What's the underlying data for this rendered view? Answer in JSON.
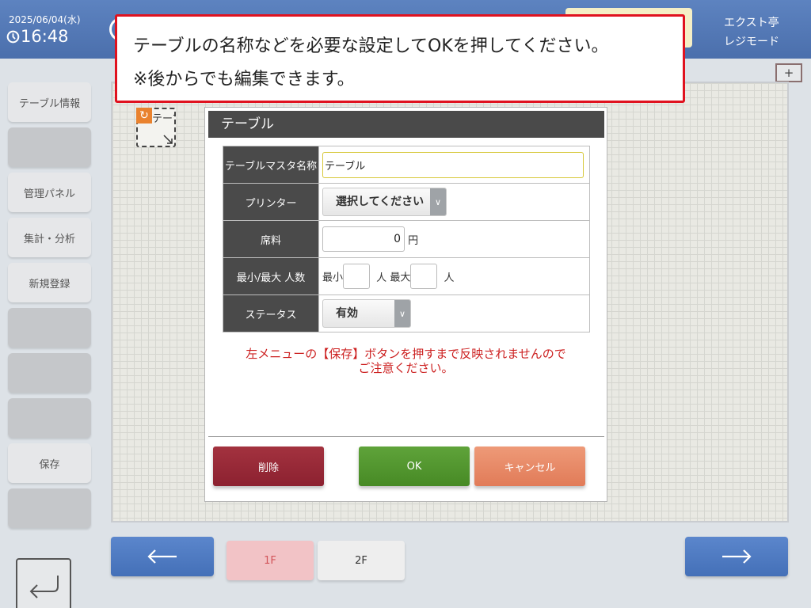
{
  "header": {
    "date": "2025/06/04(水)",
    "time": "16:48",
    "shop_name": "エクスト亭",
    "mode": "レジモード"
  },
  "sidebar": {
    "items": [
      {
        "label": "テーブル情報"
      },
      {
        "label": ""
      },
      {
        "label": "管理パネル"
      },
      {
        "label": "集計・分析"
      },
      {
        "label": "新規登録"
      },
      {
        "label": ""
      },
      {
        "label": ""
      },
      {
        "label": ""
      },
      {
        "label": "保存"
      },
      {
        "label": ""
      }
    ]
  },
  "canvas": {
    "add_button": "+",
    "table_item_label": "テーブル",
    "rotate_icon": "↻"
  },
  "banner": {
    "line1": "テーブルの名称などを必要な設定してOKを押してください。",
    "line2": "※後からでも編集できます。"
  },
  "dialog": {
    "title": "テーブル",
    "fields": {
      "master_name_label": "テーブルマスタ名称",
      "master_name_value": "テーブル",
      "printer_label": "プリンター",
      "printer_value": "選択してください",
      "fee_label": "席料",
      "fee_value": "0",
      "fee_unit": "円",
      "capacity_label": "最小/最大 人数",
      "min_label": "最小",
      "person_unit": "人",
      "max_label": "最大",
      "status_label": "ステータス",
      "status_value": "有効"
    },
    "notice_line1": "左メニューの【保存】ボタンを押すまで反映されませんので",
    "notice_line2": "ご注意ください。",
    "buttons": {
      "delete": "削除",
      "ok": "OK",
      "cancel": "キャンセル"
    }
  },
  "floors": [
    {
      "label": "1F",
      "active": true
    },
    {
      "label": "2F",
      "active": false
    }
  ],
  "colors": {
    "header": "#4b6fac",
    "banner_border": "#e0121f",
    "delete": "#8c2130",
    "ok": "#478a25",
    "cancel": "#e17b58",
    "notice": "#cc1f1f",
    "nav_arrow": "#4470b8"
  }
}
